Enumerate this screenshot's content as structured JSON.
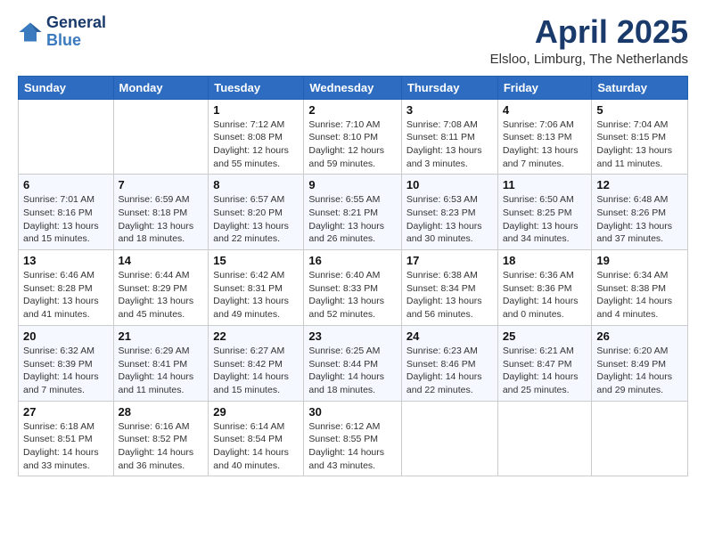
{
  "logo": {
    "text1": "General",
    "text2": "Blue"
  },
  "title": "April 2025",
  "subtitle": "Elsloo, Limburg, The Netherlands",
  "weekdays": [
    "Sunday",
    "Monday",
    "Tuesday",
    "Wednesday",
    "Thursday",
    "Friday",
    "Saturday"
  ],
  "weeks": [
    [
      {
        "day": "",
        "info": ""
      },
      {
        "day": "",
        "info": ""
      },
      {
        "day": "1",
        "info": "Sunrise: 7:12 AM\nSunset: 8:08 PM\nDaylight: 12 hours and 55 minutes."
      },
      {
        "day": "2",
        "info": "Sunrise: 7:10 AM\nSunset: 8:10 PM\nDaylight: 12 hours and 59 minutes."
      },
      {
        "day": "3",
        "info": "Sunrise: 7:08 AM\nSunset: 8:11 PM\nDaylight: 13 hours and 3 minutes."
      },
      {
        "day": "4",
        "info": "Sunrise: 7:06 AM\nSunset: 8:13 PM\nDaylight: 13 hours and 7 minutes."
      },
      {
        "day": "5",
        "info": "Sunrise: 7:04 AM\nSunset: 8:15 PM\nDaylight: 13 hours and 11 minutes."
      }
    ],
    [
      {
        "day": "6",
        "info": "Sunrise: 7:01 AM\nSunset: 8:16 PM\nDaylight: 13 hours and 15 minutes."
      },
      {
        "day": "7",
        "info": "Sunrise: 6:59 AM\nSunset: 8:18 PM\nDaylight: 13 hours and 18 minutes."
      },
      {
        "day": "8",
        "info": "Sunrise: 6:57 AM\nSunset: 8:20 PM\nDaylight: 13 hours and 22 minutes."
      },
      {
        "day": "9",
        "info": "Sunrise: 6:55 AM\nSunset: 8:21 PM\nDaylight: 13 hours and 26 minutes."
      },
      {
        "day": "10",
        "info": "Sunrise: 6:53 AM\nSunset: 8:23 PM\nDaylight: 13 hours and 30 minutes."
      },
      {
        "day": "11",
        "info": "Sunrise: 6:50 AM\nSunset: 8:25 PM\nDaylight: 13 hours and 34 minutes."
      },
      {
        "day": "12",
        "info": "Sunrise: 6:48 AM\nSunset: 8:26 PM\nDaylight: 13 hours and 37 minutes."
      }
    ],
    [
      {
        "day": "13",
        "info": "Sunrise: 6:46 AM\nSunset: 8:28 PM\nDaylight: 13 hours and 41 minutes."
      },
      {
        "day": "14",
        "info": "Sunrise: 6:44 AM\nSunset: 8:29 PM\nDaylight: 13 hours and 45 minutes."
      },
      {
        "day": "15",
        "info": "Sunrise: 6:42 AM\nSunset: 8:31 PM\nDaylight: 13 hours and 49 minutes."
      },
      {
        "day": "16",
        "info": "Sunrise: 6:40 AM\nSunset: 8:33 PM\nDaylight: 13 hours and 52 minutes."
      },
      {
        "day": "17",
        "info": "Sunrise: 6:38 AM\nSunset: 8:34 PM\nDaylight: 13 hours and 56 minutes."
      },
      {
        "day": "18",
        "info": "Sunrise: 6:36 AM\nSunset: 8:36 PM\nDaylight: 14 hours and 0 minutes."
      },
      {
        "day": "19",
        "info": "Sunrise: 6:34 AM\nSunset: 8:38 PM\nDaylight: 14 hours and 4 minutes."
      }
    ],
    [
      {
        "day": "20",
        "info": "Sunrise: 6:32 AM\nSunset: 8:39 PM\nDaylight: 14 hours and 7 minutes."
      },
      {
        "day": "21",
        "info": "Sunrise: 6:29 AM\nSunset: 8:41 PM\nDaylight: 14 hours and 11 minutes."
      },
      {
        "day": "22",
        "info": "Sunrise: 6:27 AM\nSunset: 8:42 PM\nDaylight: 14 hours and 15 minutes."
      },
      {
        "day": "23",
        "info": "Sunrise: 6:25 AM\nSunset: 8:44 PM\nDaylight: 14 hours and 18 minutes."
      },
      {
        "day": "24",
        "info": "Sunrise: 6:23 AM\nSunset: 8:46 PM\nDaylight: 14 hours and 22 minutes."
      },
      {
        "day": "25",
        "info": "Sunrise: 6:21 AM\nSunset: 8:47 PM\nDaylight: 14 hours and 25 minutes."
      },
      {
        "day": "26",
        "info": "Sunrise: 6:20 AM\nSunset: 8:49 PM\nDaylight: 14 hours and 29 minutes."
      }
    ],
    [
      {
        "day": "27",
        "info": "Sunrise: 6:18 AM\nSunset: 8:51 PM\nDaylight: 14 hours and 33 minutes."
      },
      {
        "day": "28",
        "info": "Sunrise: 6:16 AM\nSunset: 8:52 PM\nDaylight: 14 hours and 36 minutes."
      },
      {
        "day": "29",
        "info": "Sunrise: 6:14 AM\nSunset: 8:54 PM\nDaylight: 14 hours and 40 minutes."
      },
      {
        "day": "30",
        "info": "Sunrise: 6:12 AM\nSunset: 8:55 PM\nDaylight: 14 hours and 43 minutes."
      },
      {
        "day": "",
        "info": ""
      },
      {
        "day": "",
        "info": ""
      },
      {
        "day": "",
        "info": ""
      }
    ]
  ]
}
